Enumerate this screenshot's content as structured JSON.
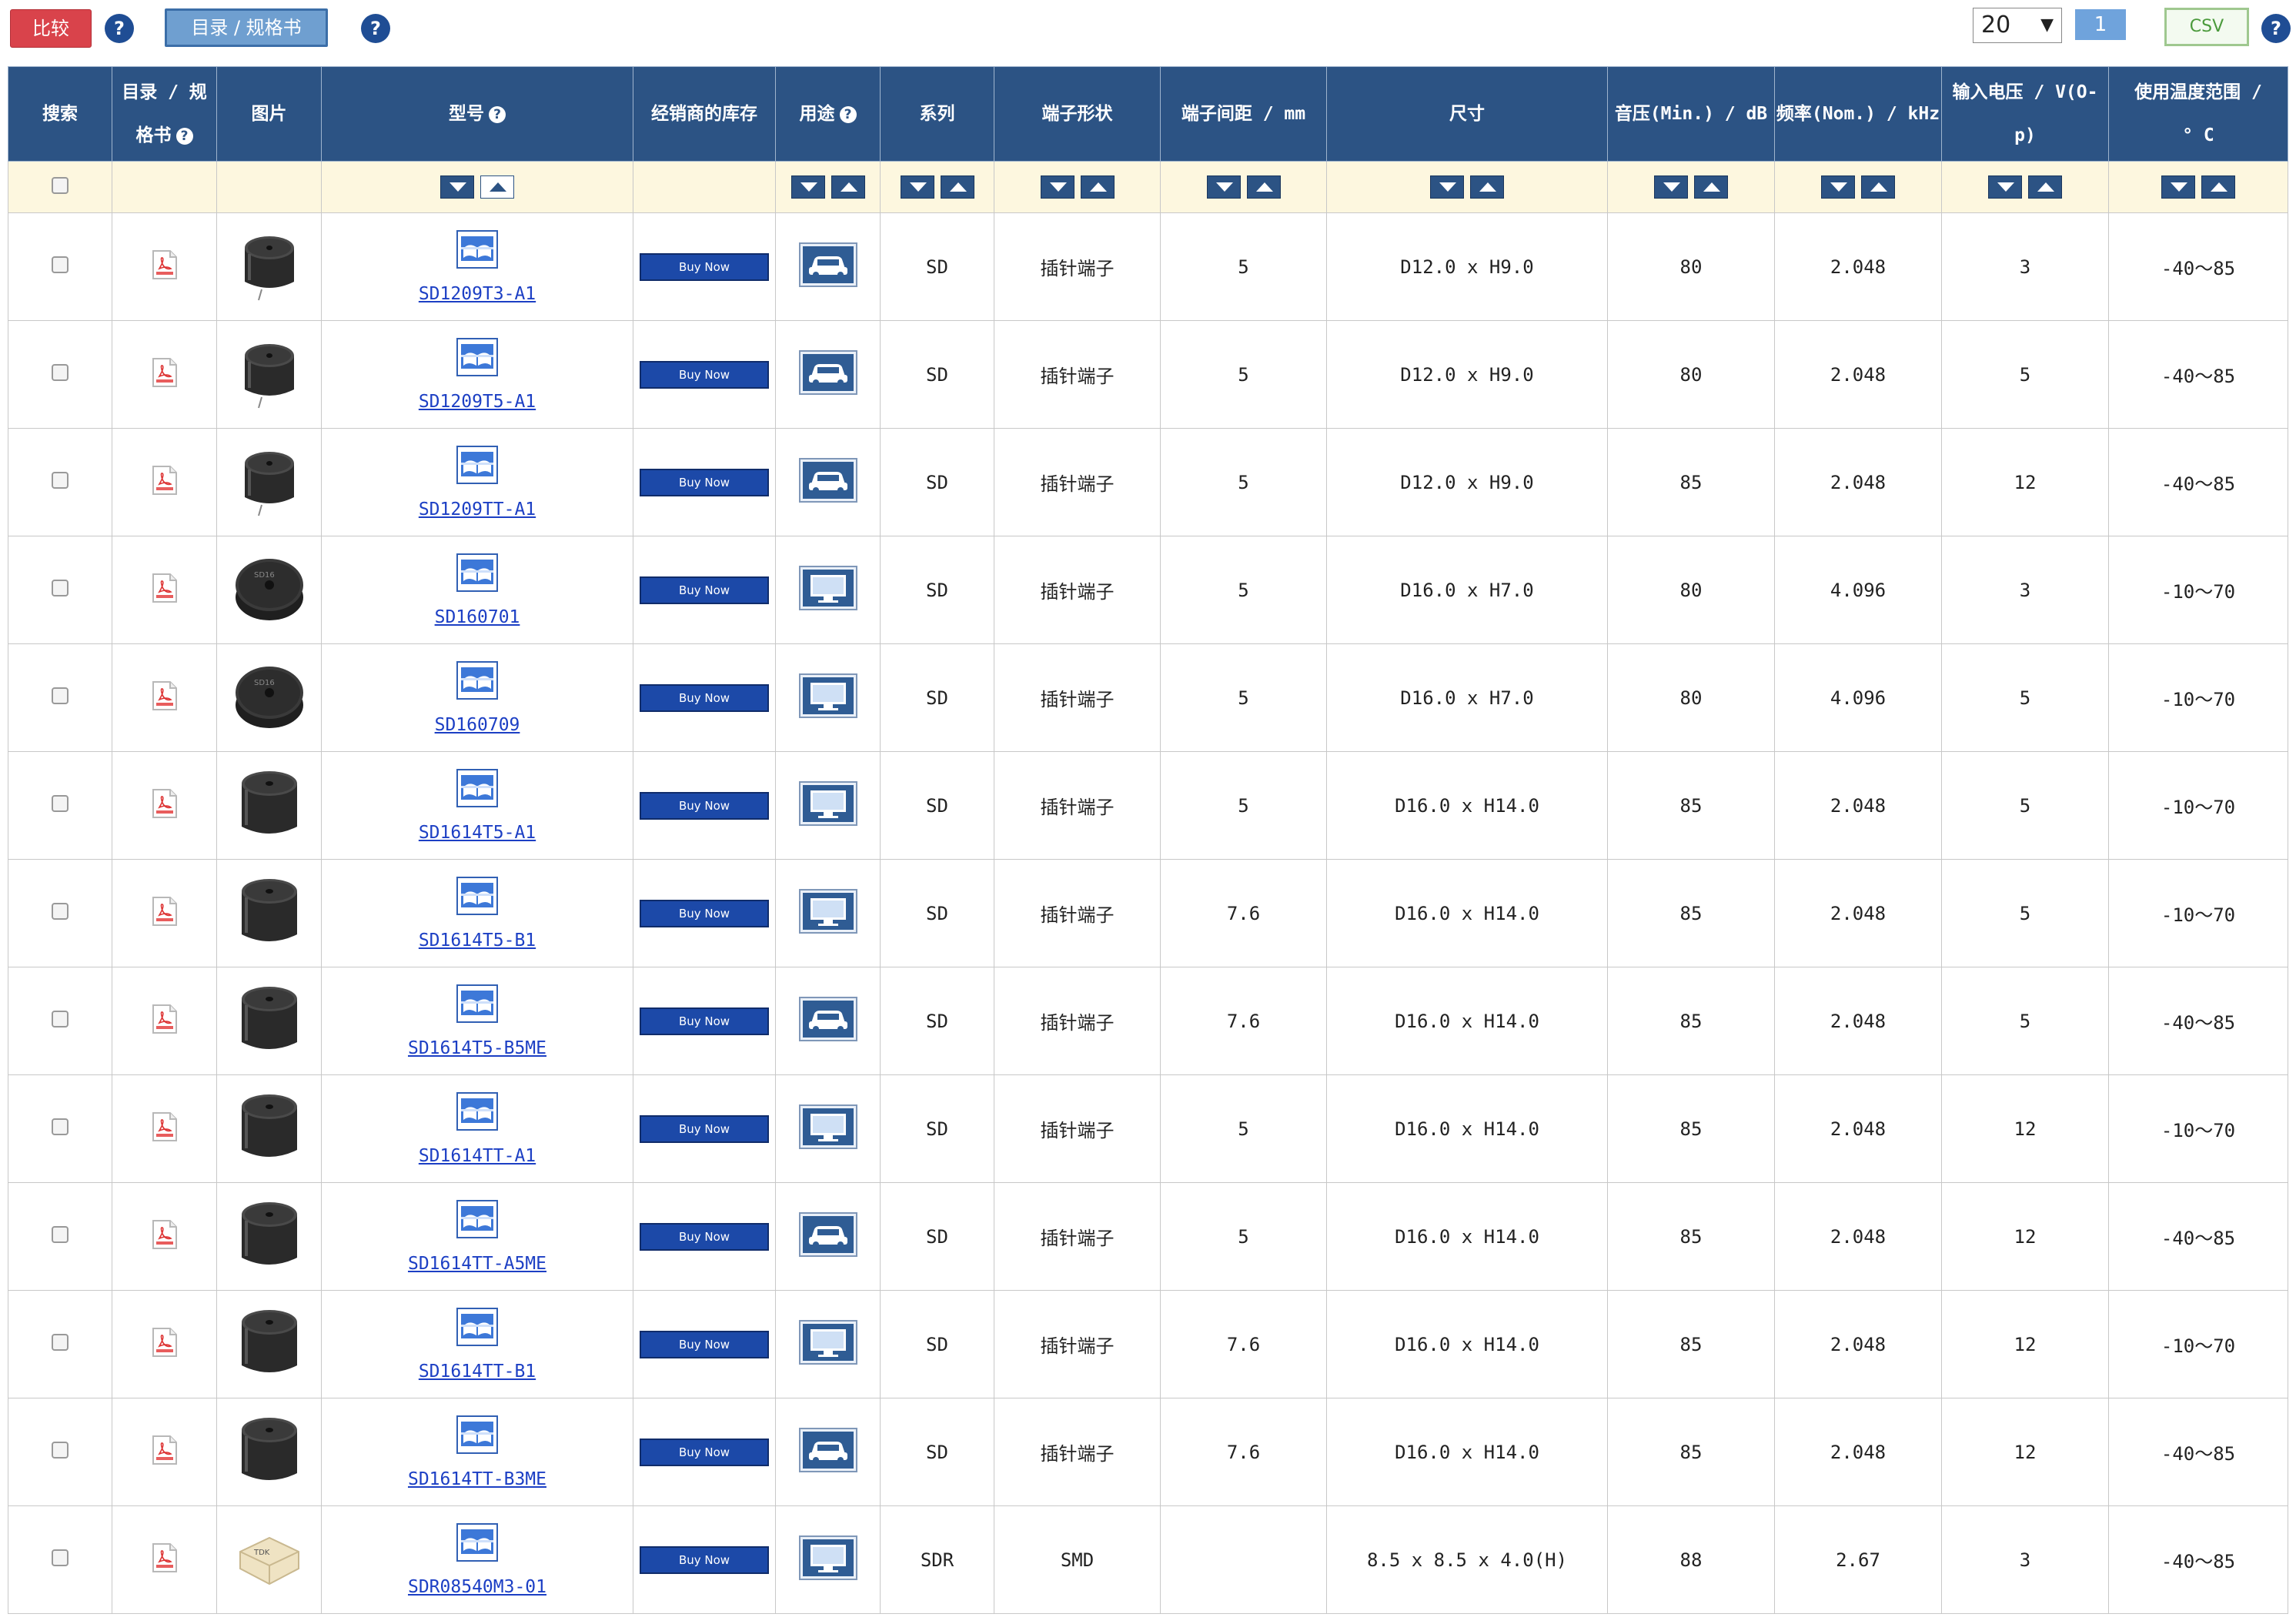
{
  "toolbar": {
    "compare_label": "比较",
    "catalog_label": "目录 / 规格书",
    "help_glyph": "?",
    "per_page": "20",
    "per_page_arrow": "▼",
    "page": "1",
    "csv_label": "CSV"
  },
  "table": {
    "headers": {
      "search": "搜索",
      "catalog_line1": "目录 / 规",
      "catalog_line2": "格书",
      "image": "图片",
      "model": "型号",
      "stock": "经销商的库存",
      "usage": "用途",
      "series": "系列",
      "terminal_shape": "端子形状",
      "terminal_pitch": "端子间距 / mm",
      "size": "尺寸",
      "spl": "音压(Min.) / dB",
      "freq": "频率(Nom.) / kHz",
      "voltage_line1": "输入电压 / V(O-",
      "voltage_line2": "p)",
      "temp_line1": "使用温度范围 /",
      "temp_line2": "° C"
    },
    "buy_label": "Buy Now",
    "rows": [
      {
        "model": "SD1209T3-A1",
        "usage": "car-icon",
        "series": "SD",
        "terminal": "插针端子",
        "pitch": "5",
        "size": "D12.0 x H9.0",
        "spl": "80",
        "freq": "2.048",
        "voltage": "3",
        "temp": "-40～85",
        "image": "buzzer-small"
      },
      {
        "model": "SD1209T5-A1",
        "usage": "car-icon",
        "series": "SD",
        "terminal": "插针端子",
        "pitch": "5",
        "size": "D12.0 x H9.0",
        "spl": "80",
        "freq": "2.048",
        "voltage": "5",
        "temp": "-40～85",
        "image": "buzzer-small"
      },
      {
        "model": "SD1209TT-A1",
        "usage": "car-icon",
        "series": "SD",
        "terminal": "插针端子",
        "pitch": "5",
        "size": "D12.0 x H9.0",
        "spl": "85",
        "freq": "2.048",
        "voltage": "12",
        "temp": "-40～85",
        "image": "buzzer-small"
      },
      {
        "model": "SD160701",
        "usage": "monitor-icon",
        "series": "SD",
        "terminal": "插针端子",
        "pitch": "5",
        "size": "D16.0 x H7.0",
        "spl": "80",
        "freq": "4.096",
        "voltage": "3",
        "temp": "-10～70",
        "image": "buzzer-flat"
      },
      {
        "model": "SD160709",
        "usage": "monitor-icon",
        "series": "SD",
        "terminal": "插针端子",
        "pitch": "5",
        "size": "D16.0 x H7.0",
        "spl": "80",
        "freq": "4.096",
        "voltage": "5",
        "temp": "-10～70",
        "image": "buzzer-flat"
      },
      {
        "model": "SD1614T5-A1",
        "usage": "monitor-icon",
        "series": "SD",
        "terminal": "插针端子",
        "pitch": "5",
        "size": "D16.0 x H14.0",
        "spl": "85",
        "freq": "2.048",
        "voltage": "5",
        "temp": "-10～70",
        "image": "buzzer-tall"
      },
      {
        "model": "SD1614T5-B1",
        "usage": "monitor-icon",
        "series": "SD",
        "terminal": "插针端子",
        "pitch": "7.6",
        "size": "D16.0 x H14.0",
        "spl": "85",
        "freq": "2.048",
        "voltage": "5",
        "temp": "-10～70",
        "image": "buzzer-tall"
      },
      {
        "model": "SD1614T5-B5ME",
        "usage": "car-icon",
        "series": "SD",
        "terminal": "插针端子",
        "pitch": "7.6",
        "size": "D16.0 x H14.0",
        "spl": "85",
        "freq": "2.048",
        "voltage": "5",
        "temp": "-40～85",
        "image": "buzzer-tall"
      },
      {
        "model": "SD1614TT-A1",
        "usage": "monitor-icon",
        "series": "SD",
        "terminal": "插针端子",
        "pitch": "5",
        "size": "D16.0 x H14.0",
        "spl": "85",
        "freq": "2.048",
        "voltage": "12",
        "temp": "-10～70",
        "image": "buzzer-tall"
      },
      {
        "model": "SD1614TT-A5ME",
        "usage": "car-icon",
        "series": "SD",
        "terminal": "插针端子",
        "pitch": "5",
        "size": "D16.0 x H14.0",
        "spl": "85",
        "freq": "2.048",
        "voltage": "12",
        "temp": "-40～85",
        "image": "buzzer-tall"
      },
      {
        "model": "SD1614TT-B1",
        "usage": "monitor-icon",
        "series": "SD",
        "terminal": "插针端子",
        "pitch": "7.6",
        "size": "D16.0 x H14.0",
        "spl": "85",
        "freq": "2.048",
        "voltage": "12",
        "temp": "-10～70",
        "image": "buzzer-tall"
      },
      {
        "model": "SD1614TT-B3ME",
        "usage": "car-icon",
        "series": "SD",
        "terminal": "插针端子",
        "pitch": "7.6",
        "size": "D16.0 x H14.0",
        "spl": "85",
        "freq": "2.048",
        "voltage": "12",
        "temp": "-40～85",
        "image": "buzzer-tall"
      },
      {
        "model": "SDR08540M3-01",
        "usage": "monitor-icon",
        "series": "SDR",
        "terminal": "SMD",
        "pitch": "",
        "size": "8.5 x 8.5 x 4.0(H)",
        "spl": "88",
        "freq": "2.67",
        "voltage": "3",
        "temp": "-40～85",
        "image": "buzzer-smd"
      }
    ]
  },
  "colors": {
    "header_bg": "#2c5384",
    "sort_row_bg": "#fdf7df",
    "compare_red": "#d9434b",
    "link_blue": "#1c3fc4",
    "buy_blue": "#1c49a8"
  }
}
